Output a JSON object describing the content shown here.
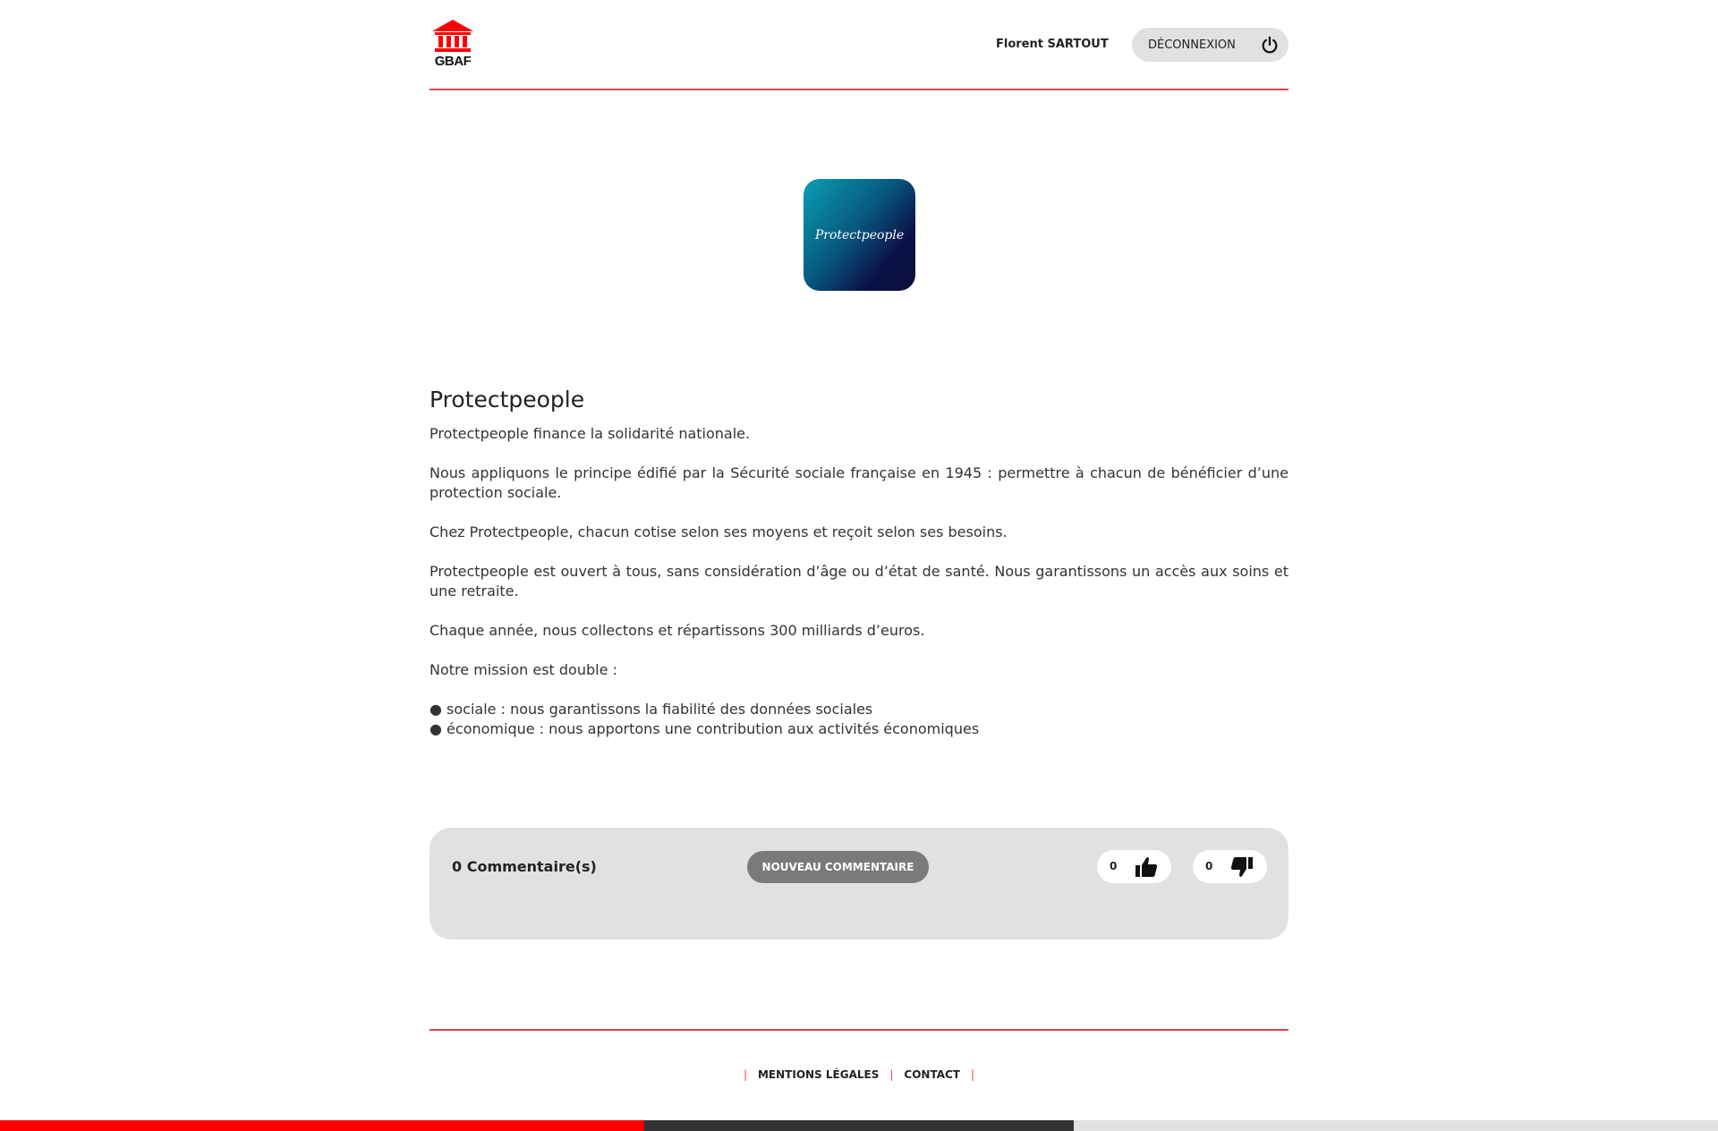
{
  "header": {
    "logo_text": "GBAF",
    "user_name": "Florent SARTOUT",
    "logout_label": "DÉCONNEXION"
  },
  "partner": {
    "logo_text": "Protectpeople",
    "name": "Protectpeople",
    "paragraphs": [
      "Protectpeople finance la solidarité nationale.",
      "Nous appliquons le principe édifié par la Sécurité sociale française en 1945 : permettre à chacun de bénéficier d’une protection sociale.",
      "Chez Protectpeople, chacun cotise selon ses moyens et reçoit selon ses besoins.",
      "Protectpeople est ouvert à tous, sans considération d’âge ou d’état de santé. Nous garantissons un accès aux soins et une retraite.",
      "Chaque année, nous collectons et répartissons 300 milliards d’euros.",
      "Notre mission est double :"
    ],
    "bullets": [
      "● sociale : nous garantissons la fiabilité des données sociales",
      "● économique : nous apportons une contribution aux activités économiques"
    ]
  },
  "comments": {
    "count_label": "0 Commentaire(s)",
    "new_comment_label": "NOUVEAU COMMENTAIRE",
    "likes": "0",
    "dislikes": "0"
  },
  "footer": {
    "separator": "|",
    "legal_label": "MENTIONS LÉGALES",
    "contact_label": "CONTACT"
  },
  "colors": {
    "accent": "#e8404a",
    "brand_red": "#ff0000",
    "panel_grey": "#e1e1e1",
    "button_grey": "#7a7a7a"
  },
  "icons": {
    "logo": "bank-building-icon",
    "logout": "power-icon",
    "like": "thumbs-up-icon",
    "dislike": "thumbs-down-icon"
  }
}
